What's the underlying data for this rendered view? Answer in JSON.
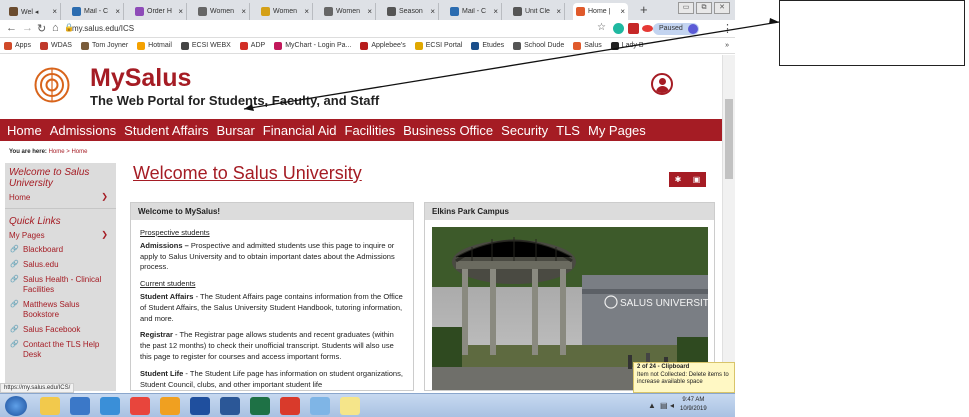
{
  "browser": {
    "tabs": [
      {
        "title": "Wel ◂",
        "color": "#6b4c2f"
      },
      {
        "title": "Mail - C",
        "color": "#2b6cb0"
      },
      {
        "title": "Order H",
        "color": "#8e4bb8"
      },
      {
        "title": "Women",
        "color": "#666666"
      },
      {
        "title": "Women",
        "color": "#d4a017"
      },
      {
        "title": "Women",
        "color": "#666666"
      },
      {
        "title": "Season",
        "color": "#555555"
      },
      {
        "title": "Mail - C",
        "color": "#2b6cb0"
      },
      {
        "title": "Unit Cle",
        "color": "#555555"
      },
      {
        "title": "Home |",
        "color": "#e05a2b"
      }
    ],
    "new_tab": "+",
    "url": "my.salus.edu/ICS",
    "profile_label": "Paused",
    "bookmarks": [
      {
        "label": "Apps",
        "color": "#d04a2a"
      },
      {
        "label": "WDAS",
        "color": "#c0392b"
      },
      {
        "label": "Tom Joyner",
        "color": "#7a5c3a"
      },
      {
        "label": "Hotmail",
        "color": "#f4a100"
      },
      {
        "label": "ECSI WEBX",
        "color": "#444444"
      },
      {
        "label": "ADP",
        "color": "#d22f27"
      },
      {
        "label": "MyChart - Login Pa...",
        "color": "#c2185b"
      },
      {
        "label": "Applebee's",
        "color": "#b71c1c"
      },
      {
        "label": "ECSI Portal",
        "color": "#e0a800"
      },
      {
        "label": "Etudes",
        "color": "#1a4f8b"
      },
      {
        "label": "School Dude",
        "color": "#555555"
      },
      {
        "label": "Salus",
        "color": "#e05a2b"
      },
      {
        "label": "Lady B",
        "color": "#222222"
      }
    ],
    "bookmarks_more": "»"
  },
  "site": {
    "brand": "MySalus",
    "tagline": "The Web Portal for Students, Faculty, and Staff",
    "nav": [
      "Home",
      "Admissions",
      "Student Affairs",
      "Bursar",
      "Financial Aid",
      "Facilities",
      "Business Office",
      "Security",
      "TLS",
      "My Pages"
    ],
    "breadcrumb": {
      "prefix": "You are here:",
      "home": "Home",
      "sep": ">",
      "current": "Home"
    },
    "page_title": "Welcome to Salus University"
  },
  "sidebar": {
    "welcome": "Welcome to Salus University",
    "home": "Home",
    "quick_links": "Quick Links",
    "my_pages": "My Pages",
    "links": [
      "Blackboard",
      "Salus.edu",
      "Salus Health - Clinical Facilities",
      "Matthews Salus Bookstore",
      "Salus Facebook",
      "Contact the TLS Help Desk"
    ]
  },
  "welcome_box": {
    "heading": "Welcome to MySalus!",
    "prospective": "Prospective students",
    "admissions_label": "Admissions –",
    "admissions_text": " Prospective and admitted students use this page to inquire or apply to Salus University and to obtain important dates about the Admissions process.",
    "current": "Current students",
    "affairs_label": "Student Affairs",
    "affairs_text": " - The Student Affairs page contains information from the Office of Student Affairs, the Salus University Student Handbook, tutoring information, and more.",
    "registrar_label": "Registrar",
    "registrar_text": " - The Registrar page allows students and recent graduates (within the past 12 months) to check their unofficial transcript. Students will also use this page to register for courses and access important forms.",
    "life_label": "Student Life",
    "life_text": " - The Student Life page has information on student organizations, Student Council, clubs, and other important student life"
  },
  "campus_box": {
    "heading": "Elkins Park Campus",
    "sign_text": "SALUS UNIVERSITY"
  },
  "status_url": "https://my.salus.edu/ICS/",
  "clipboard": {
    "title": "2 of 24 - Clipboard",
    "message": "Item not Collected: Delete items to increase available space"
  },
  "taskbar": {
    "time": "9:47 AM",
    "date": "10/9/2019",
    "apps": [
      {
        "name": "explorer",
        "color": "#f2c94c"
      },
      {
        "name": "media",
        "color": "#3b78c8"
      },
      {
        "name": "ie",
        "color": "#3a8fd8"
      },
      {
        "name": "chrome",
        "color": "#e8453c"
      },
      {
        "name": "outlook",
        "color": "#f0a020"
      },
      {
        "name": "jabber",
        "color": "#1f4f9e"
      },
      {
        "name": "word",
        "color": "#2b5797"
      },
      {
        "name": "excel",
        "color": "#1e7145"
      },
      {
        "name": "acrobat",
        "color": "#d93a2b"
      },
      {
        "name": "snipping",
        "color": "#7fb5e6"
      },
      {
        "name": "stickynotes",
        "color": "#f5e58a"
      }
    ]
  },
  "callout": {
    "text": ""
  }
}
